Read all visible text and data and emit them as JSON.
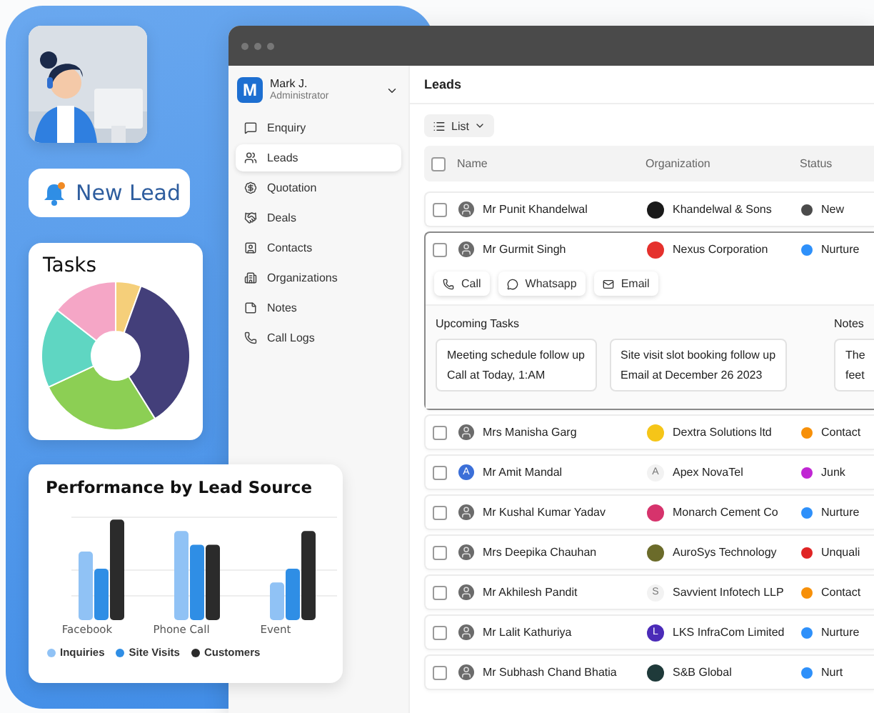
{
  "promo": {
    "new_lead_label": "New Lead",
    "tasks": {
      "title": "Tasks"
    },
    "performance": {
      "title": "Performance by Lead Source",
      "categories": [
        "Facebook",
        "Phone Call",
        "Event"
      ],
      "legend": [
        {
          "label": "Inquiries",
          "color": "#90c2f5"
        },
        {
          "label": "Site Visits",
          "color": "#2f8ee5"
        },
        {
          "label": "Customers",
          "color": "#2b2b2b"
        }
      ]
    }
  },
  "app": {
    "user": {
      "initial": "M",
      "name": "Mark J.",
      "role": "Administrator"
    },
    "sidebar": {
      "items": [
        {
          "label": "Enquiry",
          "selected": false
        },
        {
          "label": "Leads",
          "selected": true
        },
        {
          "label": "Quotation",
          "selected": false
        },
        {
          "label": "Deals",
          "selected": false
        },
        {
          "label": "Contacts",
          "selected": false
        },
        {
          "label": "Organizations",
          "selected": false
        },
        {
          "label": "Notes",
          "selected": false
        },
        {
          "label": "Call Logs",
          "selected": false
        }
      ]
    },
    "page_title": "Leads",
    "view_button": "List",
    "table": {
      "header_checked": false,
      "columns": [
        "Name",
        "Organization",
        "Status"
      ],
      "rows": [
        {
          "checked": false,
          "expanded": false,
          "name": "Mr Punit Khandelwal",
          "org_logo": {
            "kind": "mark",
            "color": "#1a1a1a"
          },
          "organization": "Khandelwal & Sons",
          "status": "New",
          "color": "#4b4b4b"
        },
        {
          "checked": false,
          "expanded": true,
          "name": "Mr Gurmit Singh",
          "org_logo": {
            "kind": "mark",
            "color": "#e5312d"
          },
          "organization": "Nexus Corporation",
          "status": "Nurture",
          "color": "#2e90fa",
          "details": {
            "actions": [
              {
                "label": "Call"
              },
              {
                "label": "Whatsapp"
              },
              {
                "label": "Email"
              }
            ],
            "tasks_title": "Upcoming Tasks",
            "tasks": [
              {
                "title": "Meeting schedule follow up",
                "when": "Call at Today, 1:AM"
              },
              {
                "title": "Site visit slot booking follow up",
                "when": "Email at December 26 2023"
              }
            ],
            "notes_title": "Notes",
            "notes": [
              "The",
              "feet"
            ]
          }
        },
        {
          "checked": false,
          "expanded": false,
          "name": "Mrs Manisha Garg",
          "org_logo": {
            "kind": "mark",
            "color": "#f5c518"
          },
          "organization": "Dextra Solutions ltd",
          "status": "Contact",
          "color": "#f79009"
        },
        {
          "checked": false,
          "expanded": false,
          "avatar": {
            "kind": "letter",
            "text": "A",
            "color": "#3b6fd8"
          },
          "name": "Mr Amit Mandal",
          "org_logo": {
            "kind": "letter",
            "text": "A",
            "color": "#f2f2f2"
          },
          "organization": "Apex NovaTel",
          "status": "Junk",
          "color": "#c026d3"
        },
        {
          "checked": false,
          "expanded": false,
          "name": "Mr Kushal Kumar Yadav",
          "org_logo": {
            "kind": "mark",
            "color": "#d6336c"
          },
          "organization": "Monarch Cement Co",
          "status": "Nurture",
          "color": "#2e90fa"
        },
        {
          "checked": false,
          "expanded": false,
          "name": "Mrs Deepika Chauhan",
          "org_logo": {
            "kind": "mark",
            "color": "#6b6b2a"
          },
          "organization": "AuroSys Technology",
          "status": "Unquali",
          "color": "#e02424"
        },
        {
          "checked": false,
          "expanded": false,
          "name": "Mr Akhilesh Pandit",
          "org_logo": {
            "kind": "letter",
            "text": "S",
            "color": "#f2f2f2"
          },
          "organization": "Savvient Infotech LLP",
          "status": "Contact",
          "color": "#f79009"
        },
        {
          "checked": false,
          "expanded": false,
          "name": "Mr Lalit Kathuriya",
          "org_logo": {
            "kind": "letter",
            "text": "L",
            "color": "#4b2bb8"
          },
          "organization": "LKS InfraCom Limited",
          "status": "Nurture",
          "color": "#2e90fa"
        },
        {
          "checked": false,
          "expanded": false,
          "name": "Mr Subhash Chand Bhatia",
          "org_logo": {
            "kind": "mark",
            "color": "#1f3a3a"
          },
          "organization": "S&B Global",
          "status": "Nurt",
          "color": "#2e90fa"
        }
      ]
    }
  }
}
